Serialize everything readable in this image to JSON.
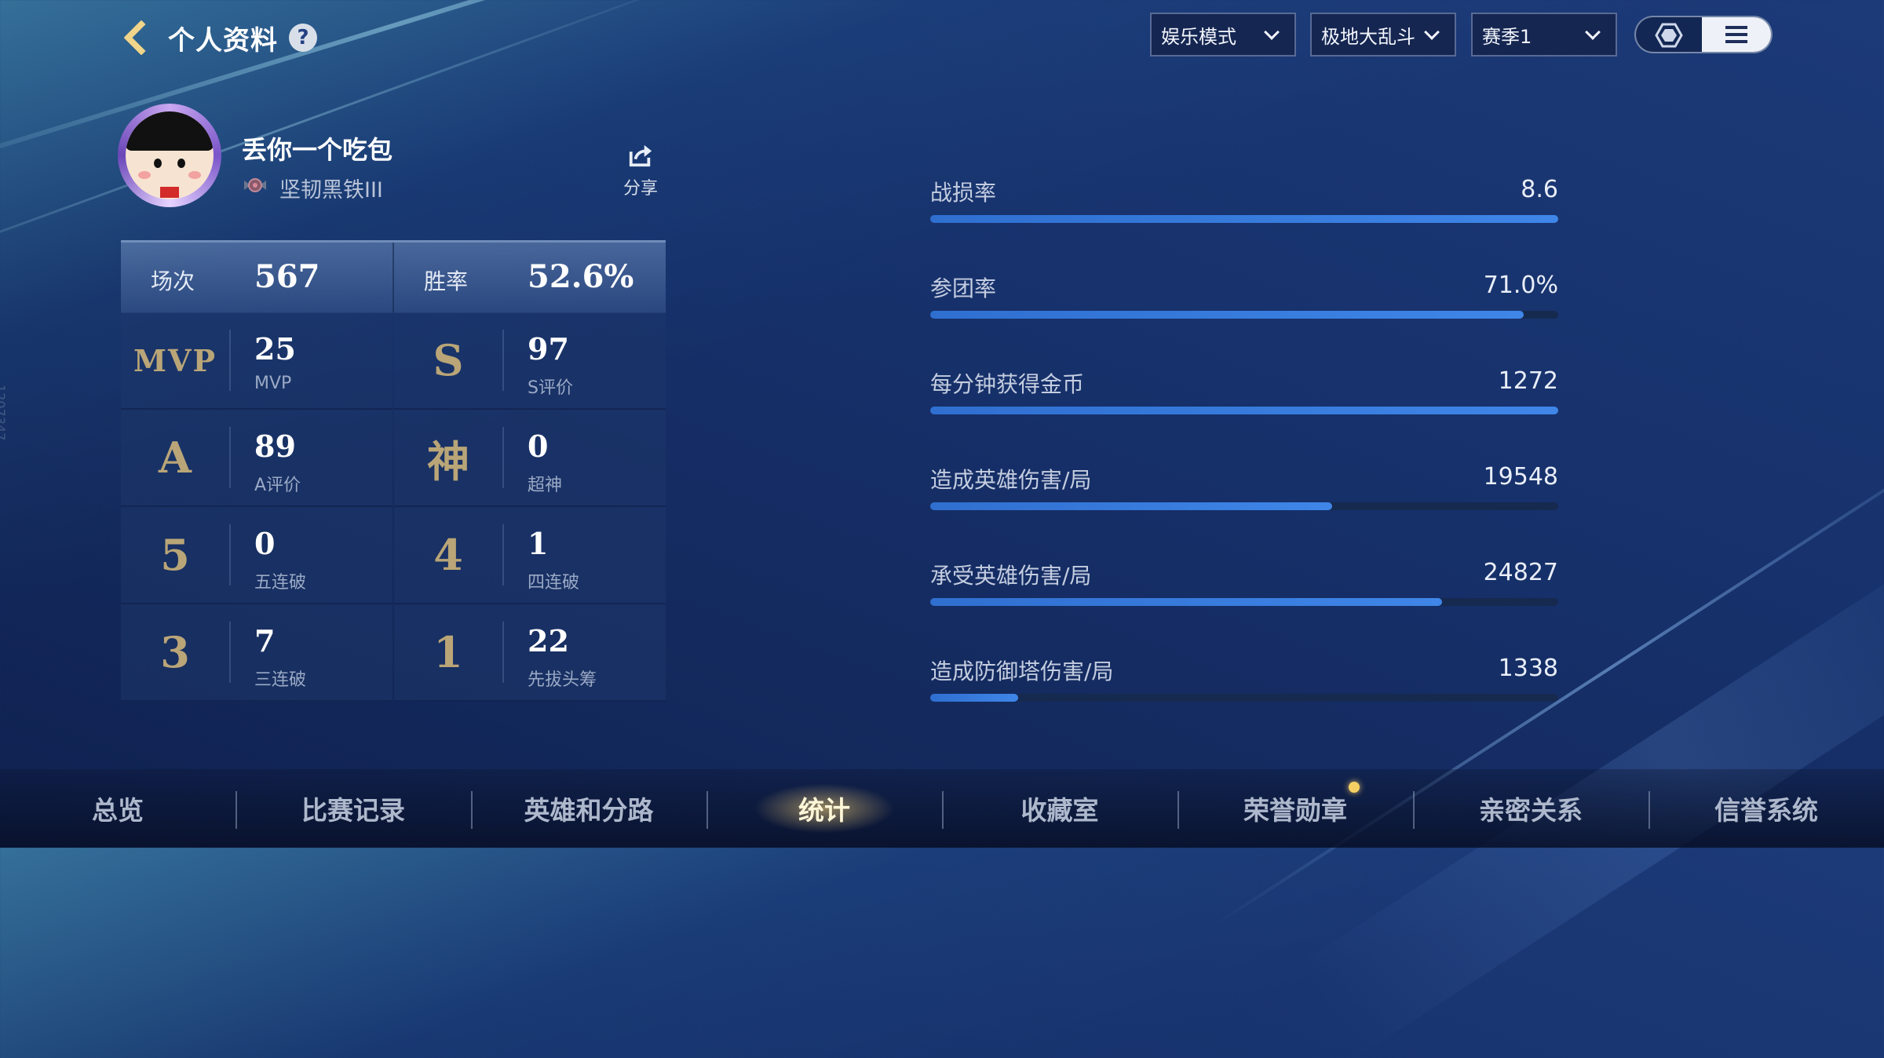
{
  "header": {
    "title": "个人资料",
    "help_symbol": "?",
    "filters": {
      "mode": "娱乐模式",
      "map": "极地大乱斗",
      "season": "赛季1"
    }
  },
  "profile": {
    "username": "丢你一个吃包",
    "rank": "坚韧黑铁III",
    "share_label": "分享",
    "side_id": "1207347"
  },
  "stats": {
    "matches_label": "场次",
    "matches_value": "567",
    "winrate_label": "胜率",
    "winrate_value": "52.6%",
    "cells": [
      {
        "icon": "MVP",
        "value": "25",
        "label": "MVP"
      },
      {
        "icon": "S",
        "value": "97",
        "label": "S评价"
      },
      {
        "icon": "A",
        "value": "89",
        "label": "A评价"
      },
      {
        "icon": "神",
        "value": "0",
        "label": "超神"
      },
      {
        "icon": "5",
        "value": "0",
        "label": "五连破"
      },
      {
        "icon": "4",
        "value": "1",
        "label": "四连破"
      },
      {
        "icon": "3",
        "value": "7",
        "label": "三连破"
      },
      {
        "icon": "1",
        "value": "22",
        "label": "先拔头筹"
      }
    ]
  },
  "metrics": [
    {
      "label": "战损率",
      "value": "8.6",
      "fill": 1.0
    },
    {
      "label": "参团率",
      "value": "71.0%",
      "fill": 0.945
    },
    {
      "label": "每分钟获得金币",
      "value": "1272",
      "fill": 1.0
    },
    {
      "label": "造成英雄伤害/局",
      "value": "19548",
      "fill": 0.64
    },
    {
      "label": "承受英雄伤害/局",
      "value": "24827",
      "fill": 0.815
    },
    {
      "label": "造成防御塔伤害/局",
      "value": "1338",
      "fill": 0.14
    }
  ],
  "tabs": [
    {
      "label": "总览"
    },
    {
      "label": "比赛记录"
    },
    {
      "label": "英雄和分路"
    },
    {
      "label": "统计",
      "active": true
    },
    {
      "label": "收藏室"
    },
    {
      "label": "荣誉勋章",
      "badge": true
    },
    {
      "label": "亲密关系"
    },
    {
      "label": "信誉系统"
    }
  ],
  "colors": {
    "accent_gold": "#f0d58a",
    "bar_fill": "#3f86e8",
    "bar_track": "#16294f"
  }
}
